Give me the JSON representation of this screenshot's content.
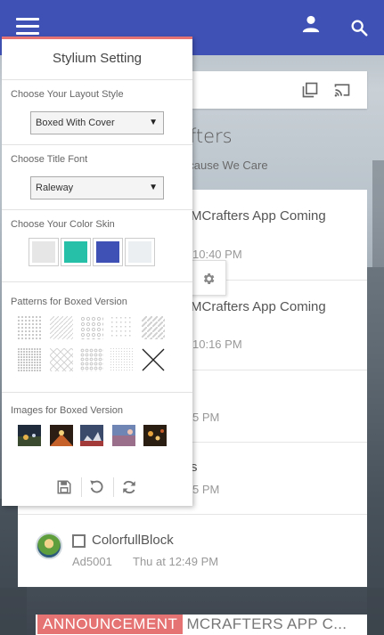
{
  "appbar": {
    "menu_icon": "hamburger-icon",
    "user_icon": "user-icon",
    "search_icon": "search-icon"
  },
  "content": {
    "forum_title_fragment": "afters",
    "forum_subtitle_fragment": "ecause We Care",
    "rows": [
      {
        "title": "MCrafters App Coming",
        "time": "10:40 PM"
      },
      {
        "title": "MCrafters App Coming",
        "time": "10:16 PM"
      },
      {
        "title": "",
        "time": "5 PM"
      },
      {
        "title": "s",
        "time": "5 PM"
      },
      {
        "title": "ColorfullBlock",
        "author": "Ad5001",
        "time": "Thu at 12:49 PM"
      }
    ],
    "announcement_badge": "ANNOUNCEMENT",
    "announcement_text": "MCRAFTERS APP C..."
  },
  "panel": {
    "title": "Stylium Setting",
    "layout_label": "Choose Your Layout Style",
    "layout_value": "Boxed With Cover",
    "font_label": "Choose Title Font",
    "font_value": "Raleway",
    "color_label": "Choose Your Color Skin",
    "skins": [
      "#e6e6e6",
      "#26bfa8",
      "#3f51b5",
      "#eceff1"
    ],
    "patterns_label": "Patterns for Boxed Version",
    "images_label": "Images for Boxed Version",
    "dropdown_arrow": "▼",
    "tool_icons": [
      "save-icon",
      "undo-icon",
      "refresh-icon"
    ]
  },
  "colors": {
    "primary": "#3f51b5",
    "accent": "#e57373"
  }
}
